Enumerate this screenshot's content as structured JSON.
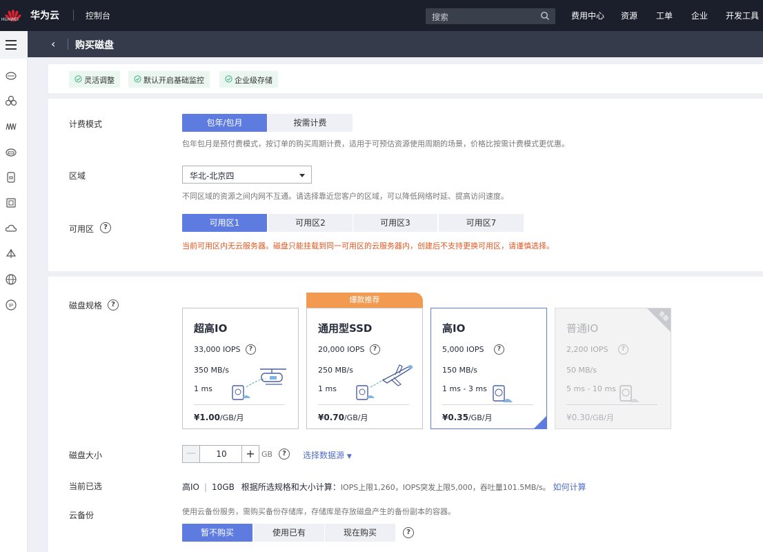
{
  "topbar": {
    "logo_text": "HUAWEI",
    "brand": "华为云",
    "console": "控制台",
    "search_placeholder": "搜索",
    "nav": [
      "费用中心",
      "资源",
      "工单",
      "企业",
      "开发工具"
    ]
  },
  "header": {
    "title": "购买磁盘"
  },
  "features": [
    "灵活调整",
    "默认开启基础监控",
    "企业级存储"
  ],
  "billing": {
    "label": "计费模式",
    "options": [
      "包年/包月",
      "按需计费"
    ],
    "selected": "包年/包月",
    "hint": "包年包月是预付费模式，按订单的购买周期计费，适用于可预估资源使用周期的场景，价格比按需计费模式更优惠。"
  },
  "region": {
    "label": "区域",
    "value": "华北-北京四",
    "hint": "不同区域的资源之间内网不互通。请选择靠近您客户的区域，可以降低网络时延、提高访问速度。"
  },
  "az": {
    "label": "可用区",
    "options": [
      "可用区1",
      "可用区2",
      "可用区3",
      "可用区7"
    ],
    "selected": "可用区1",
    "warning": "当前可用区内无云服务器。磁盘只能挂载到同一可用区的云服务器内，创建后不支持更换可用区，请谨慎选择。"
  },
  "spec": {
    "label": "磁盘规格",
    "ribbon": "爆款推荐",
    "cards": [
      {
        "title": "超高IO",
        "iops": "33,000 IOPS",
        "throughput": "350 MB/s",
        "latency": "1 ms",
        "price": "¥1.00",
        "unit": "/GB/月"
      },
      {
        "title": "通用型SSD",
        "iops": "20,000 IOPS",
        "throughput": "250 MB/s",
        "latency": "1 ms",
        "price": "¥0.70",
        "unit": "/GB/月"
      },
      {
        "title": "高IO",
        "iops": "5,000 IOPS",
        "throughput": "150 MB/s",
        "latency": "1 ms - 3 ms",
        "price": "¥0.35",
        "unit": "/GB/月"
      },
      {
        "title": "普通IO",
        "iops": "2,200 IOPS",
        "throughput": "50 MB/s",
        "latency": "5 ms - 10 ms",
        "price": "¥0.30",
        "unit": "/GB/月",
        "tag": "售罄"
      }
    ],
    "selected": "高IO"
  },
  "size": {
    "label": "磁盘大小",
    "minus": "—",
    "value": "10",
    "plus": "+",
    "unit": "GB",
    "datasource": "选择数据源"
  },
  "current": {
    "label": "当前已选",
    "type": "高IO",
    "size": "10GB",
    "calc_prefix": "根据所选规格和大小计算：",
    "calc": "IOPS上限1,260，IOPS突发上限5,000，吞吐量101.5MB/s。",
    "link": "如何计算"
  },
  "backup": {
    "label": "云备份",
    "hint": "使用云备份服务，需购买备份存储库，存储库是存放磁盘产生的备份副本的容器。",
    "options": [
      "暂不购买",
      "使用已有",
      "现在购买"
    ],
    "selected": "暂不购买"
  },
  "help_glyph": "?",
  "colors": {
    "accent": "#5e7ce0",
    "warning": "#e5561f",
    "topbar": "#1b1f2b",
    "header": "#353b4a",
    "ribbon": "#f19a50"
  }
}
